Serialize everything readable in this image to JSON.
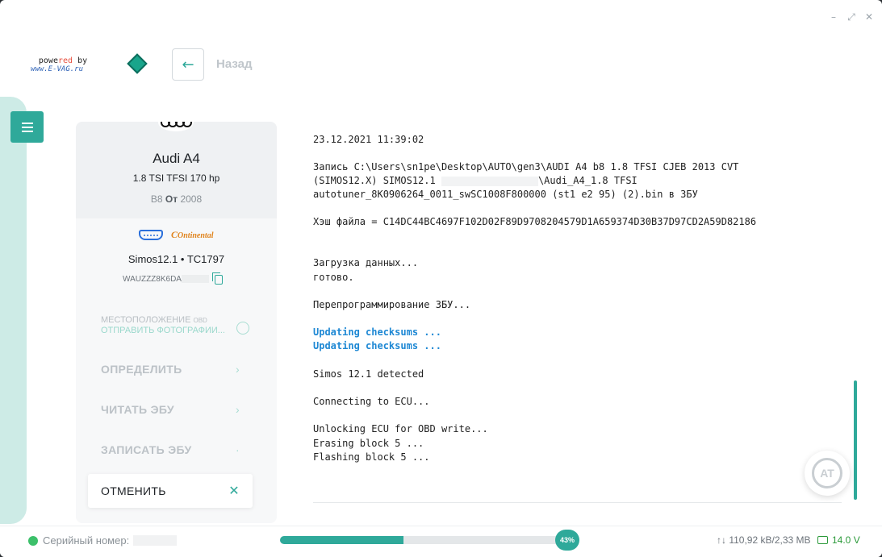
{
  "window": {
    "controls": [
      "–",
      "⤢",
      "✕"
    ]
  },
  "header": {
    "powered_prefix": "powe",
    "powered_red": "red",
    "powered_suffix": " by",
    "powered_site": "www.E-VAG.ru",
    "back_label": "Назад",
    "back_icon": "←"
  },
  "vehicle": {
    "model": "Audi A4",
    "engine": "1.8 TSI TFSI 170 hp",
    "generation_prefix": "B8",
    "generation_from": "От",
    "generation_year": "2008",
    "ecu_brand": "Ontinental",
    "ecu": "Simos12.1 • TC1797",
    "vin_prefix": "WAUZZZ8K6DA"
  },
  "location": {
    "label": "МЕСТОПОЛОЖЕНИЕ",
    "label_tag": "OBD",
    "send_photos": "ОТПРАВИТЬ ФОТОГРАФИИ..."
  },
  "actions": [
    {
      "label": "ОПРЕДЕЛИТЬ",
      "chev": "›"
    },
    {
      "label": "ЧИТАТЬ ЭБУ",
      "chev": "›"
    },
    {
      "label": "ЗАПИСАТЬ ЭБУ",
      "chev": "·"
    }
  ],
  "cancel": {
    "label": "ОТМЕНИТЬ",
    "icon": "✕"
  },
  "log": {
    "timestamp": "23.12.2021 11:39:02",
    "write_line1": "Запись C:\\Users\\sn1pe\\Desktop\\AUTO\\gen3\\AUDI A4 b8 1.8 TFSI CJEB 2013 CVT",
    "write_line2a": "(SIMOS12.X) SIMOS12.1 ",
    "write_line2b": "\\Audi_A4_1.8 TFSI",
    "write_line3": "autotuner_8K0906264_0011_swSC1008F800000 (st1 e2 95) (2).bin в ЗБУ",
    "hash": "Хэш файла = C14DC44BC4697F102D02F89D9708204579D1A659374D30B37D97CD2A59D82186",
    "loading": "Загрузка данных...",
    "done": "готово.",
    "reprog": "Перепрограммирование ЗБУ...",
    "checksums1": "Updating checksums ...",
    "checksums2": "Updating checksums ...",
    "detected": "Simos 12.1 detected",
    "connecting": "Connecting to ECU...",
    "unlocking": "Unlocking ECU for OBD write...",
    "erasing": "Erasing block 5 ...",
    "flashing": "Flashing block 5 ..."
  },
  "status": {
    "serial_label": "Серийный номер:",
    "progress_percent": 43,
    "progress_label": "43%",
    "traffic": "↑↓ 110,92 kB/2,33 MB",
    "voltage": "14.0 V"
  },
  "colors": {
    "accent": "#2fa99a",
    "log_highlight": "#1e88d4",
    "online": "#3cc06a",
    "battery": "#2b9a3a"
  }
}
